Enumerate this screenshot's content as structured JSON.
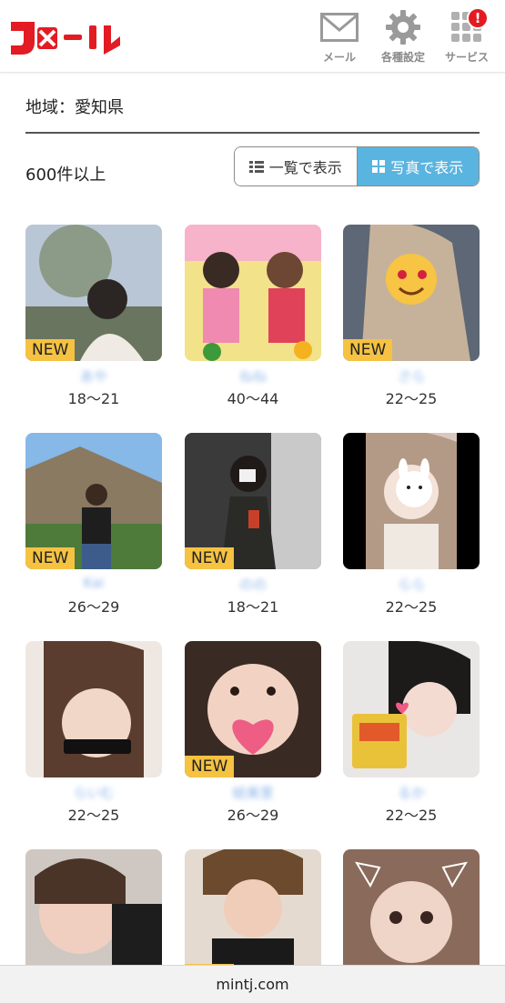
{
  "header": {
    "logo_text": "Jメール",
    "nav": [
      {
        "label": "メール",
        "icon": "mail-icon"
      },
      {
        "label": "各種設定",
        "icon": "gear-icon"
      },
      {
        "label": "サービス",
        "icon": "grid-icon",
        "badge": "!"
      }
    ],
    "brand_color": "#e31b23"
  },
  "filter": {
    "region_label": "地域：愛知県"
  },
  "results": {
    "count_label": "600件以上",
    "view_list_label": "一覧で表示",
    "view_photo_label": "写真で表示",
    "selected_view": "photo"
  },
  "profiles": [
    {
      "name": "あや",
      "age": "18〜21",
      "new": true
    },
    {
      "name": "ねね",
      "age": "40〜44",
      "new": false
    },
    {
      "name": "さら",
      "age": "22〜25",
      "new": true
    },
    {
      "name": "Kai",
      "age": "26〜29",
      "new": true
    },
    {
      "name": "のの",
      "age": "18〜21",
      "new": true
    },
    {
      "name": "らら",
      "age": "22〜25",
      "new": false
    },
    {
      "name": "らいむ",
      "age": "22〜25",
      "new": false
    },
    {
      "name": "絵美里",
      "age": "26〜29",
      "new": true
    },
    {
      "name": "るか",
      "age": "22〜25",
      "new": false
    },
    {
      "name": "",
      "age": "",
      "new": false
    },
    {
      "name": "",
      "age": "",
      "new": true
    },
    {
      "name": "",
      "age": "",
      "new": false
    }
  ],
  "new_tag_label": "NEW",
  "browser": {
    "url": "mintj.com"
  }
}
